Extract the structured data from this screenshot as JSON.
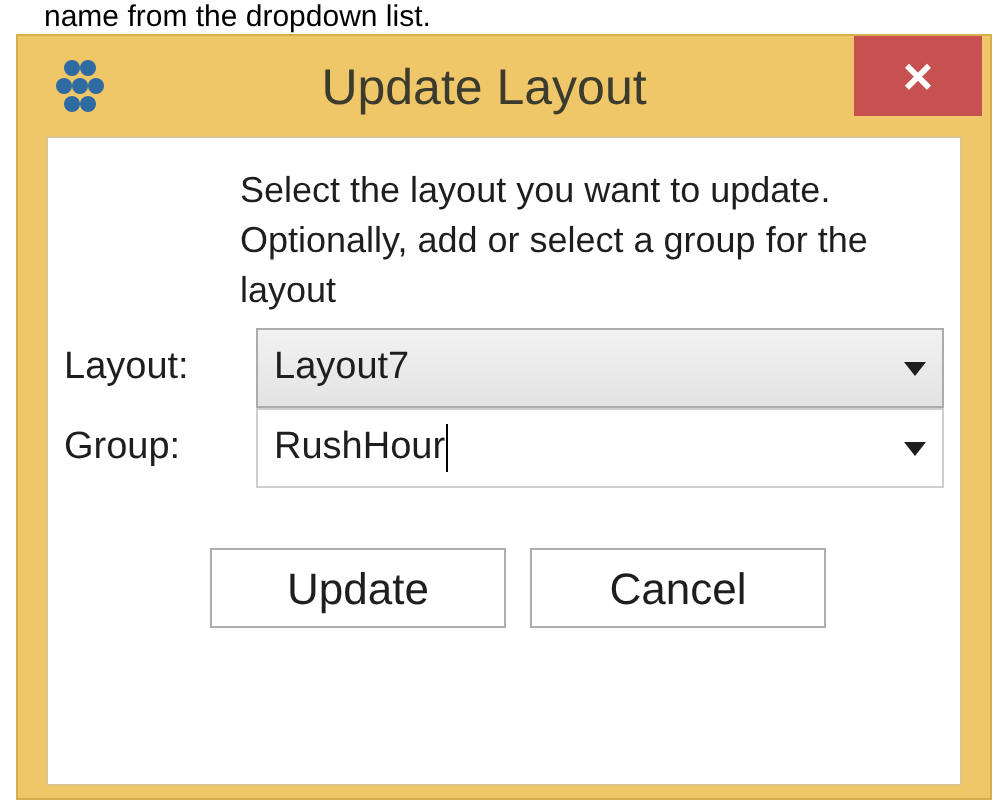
{
  "document_text": "name from the dropdown list.",
  "window": {
    "title": "Update Layout",
    "close_label": "×"
  },
  "instructions": "Select the layout you want to update. Optionally, add or select a group for the layout",
  "fields": [
    {
      "label": "Layout:",
      "value": "Layout7",
      "kind": "dropdown",
      "focused": false
    },
    {
      "label": "Group:",
      "value": "RushHour",
      "kind": "editable",
      "focused": true
    }
  ],
  "buttons": [
    "Update",
    "Cancel"
  ]
}
